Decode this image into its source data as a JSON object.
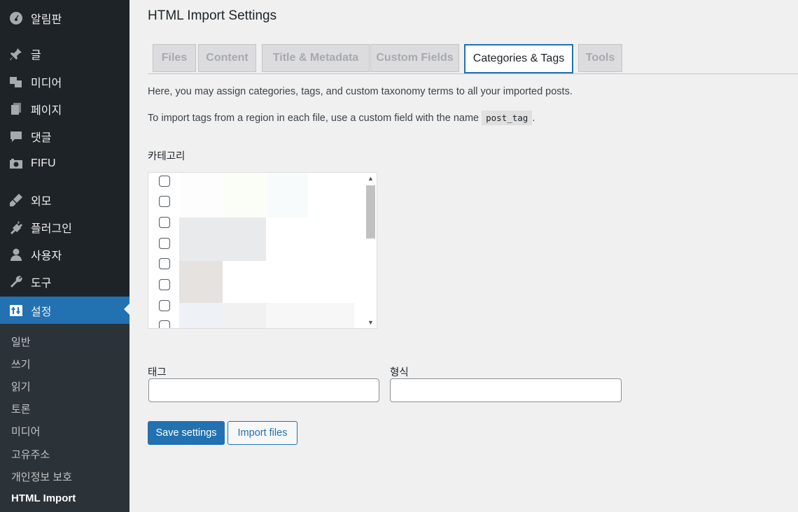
{
  "sidebar": {
    "items": [
      {
        "label": "알림판",
        "icon": "dashboard-icon"
      },
      {
        "label": "글",
        "icon": "pin-icon"
      },
      {
        "label": "미디어",
        "icon": "media-icon"
      },
      {
        "label": "페이지",
        "icon": "page-icon"
      },
      {
        "label": "댓글",
        "icon": "comment-icon"
      },
      {
        "label": "FIFU",
        "icon": "camera-icon"
      },
      {
        "label": "외모",
        "icon": "brush-icon"
      },
      {
        "label": "플러그인",
        "icon": "plugin-icon"
      },
      {
        "label": "사용자",
        "icon": "user-icon"
      },
      {
        "label": "도구",
        "icon": "wrench-icon"
      },
      {
        "label": "설정",
        "icon": "settings-icon"
      }
    ],
    "submenu": [
      "일반",
      "쓰기",
      "읽기",
      "토론",
      "미디어",
      "고유주소",
      "개인정보 보호",
      "HTML Import"
    ],
    "accent": "#2271b1"
  },
  "page": {
    "title": "HTML Import Settings",
    "tabs": [
      "Files",
      "Content",
      "Title & Metadata",
      "Custom Fields",
      "Categories & Tags",
      "Tools"
    ],
    "active_tab": "Categories & Tags",
    "help1": "Here, you may assign categories, tags, and custom taxonomy terms to all your imported posts.",
    "help2_prefix": "To import tags from a region in each file, use a custom field with the name",
    "help2_code": "post_tag",
    "help2_suffix": ".",
    "category_label": "카테고리",
    "tags_label": "태그",
    "format_label": "형식",
    "tags_value": "",
    "format_value": "",
    "save_label": "Save settings",
    "import_label": "Import files"
  }
}
